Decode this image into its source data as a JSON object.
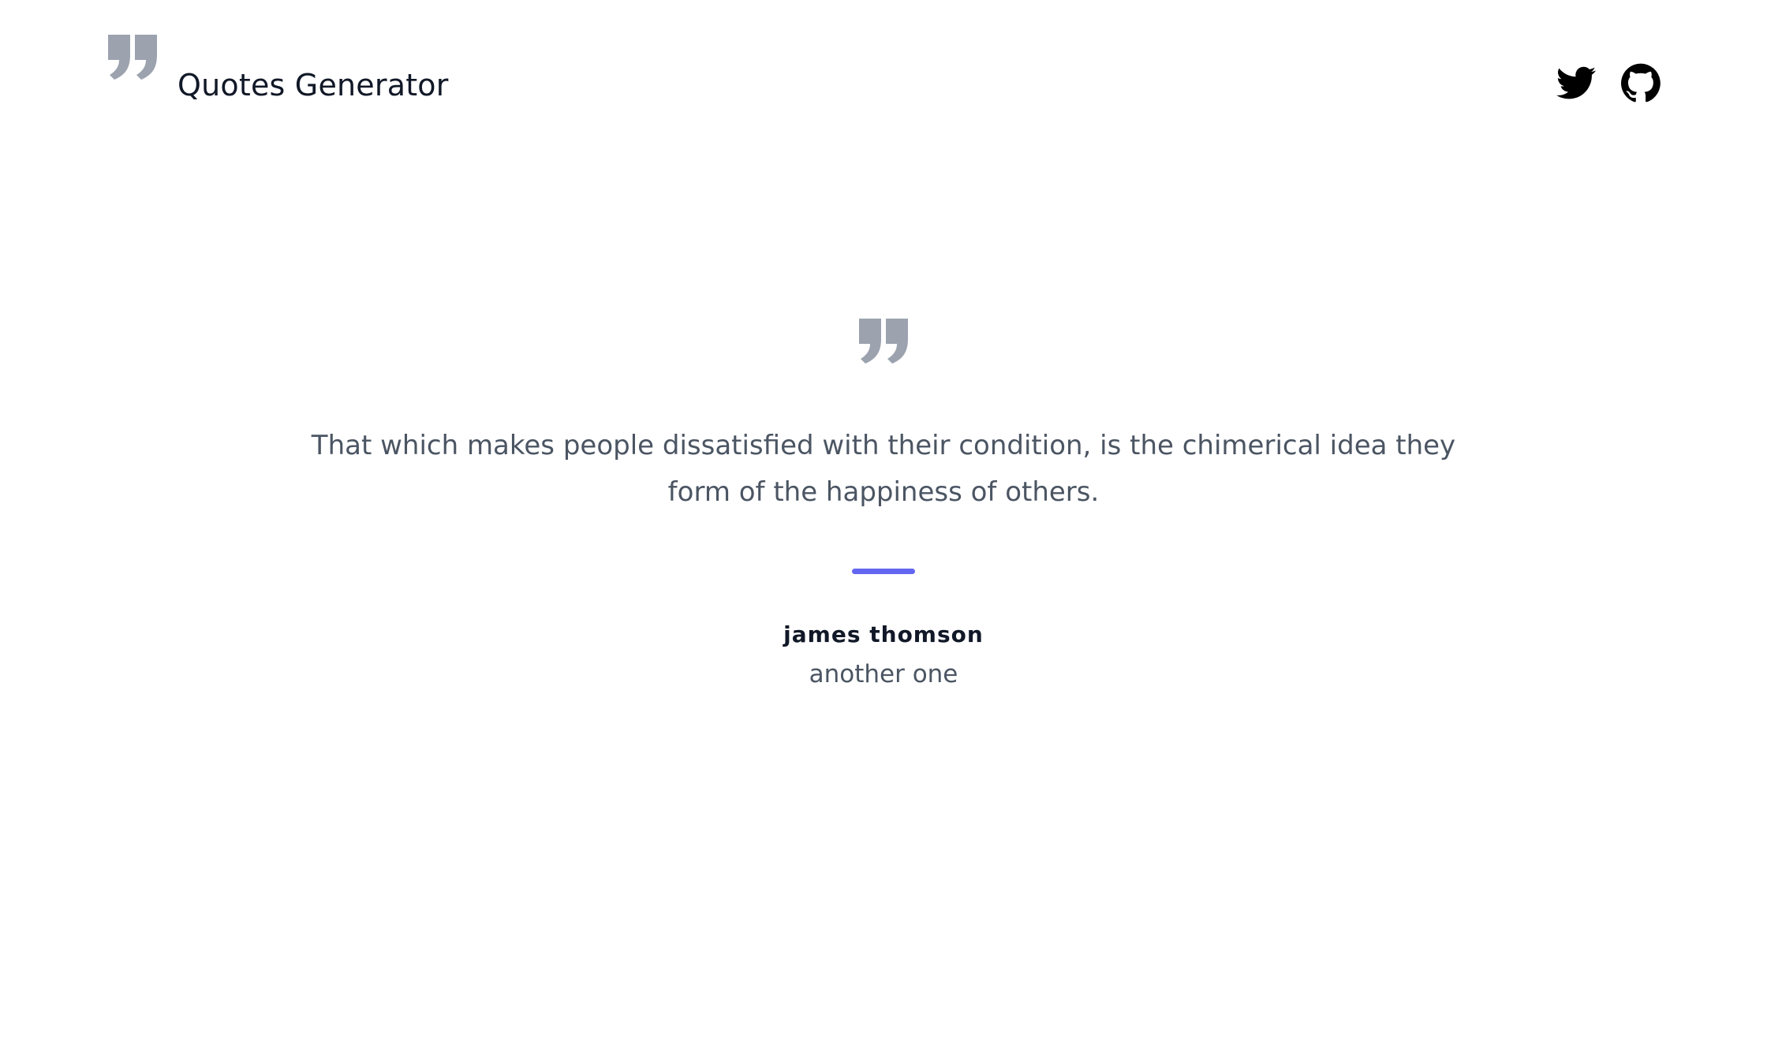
{
  "header": {
    "title": "Quotes Generator",
    "logo_icon": "quote-icon",
    "social": [
      {
        "name": "twitter-icon"
      },
      {
        "name": "github-icon"
      }
    ]
  },
  "quote": {
    "icon": "quote-icon",
    "text": "That which makes people dissatisfied with their condition, is the chimerical idea they form of the happiness of others.",
    "author": "james thomson",
    "tag": "another one"
  },
  "colors": {
    "accent": "#6366f1",
    "quote_icon": "#9ca3af",
    "heading": "#111827",
    "body_text": "#4b5563"
  }
}
